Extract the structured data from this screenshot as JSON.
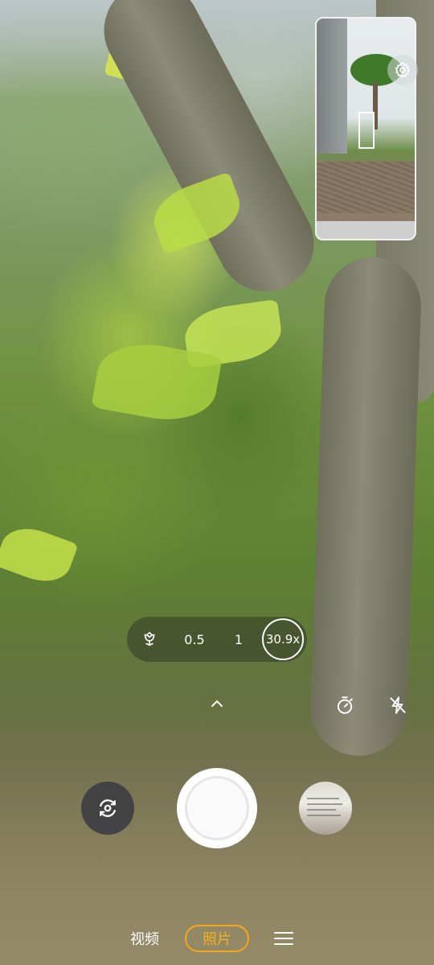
{
  "zoom_bar": {
    "macro_icon": "macro-flower-icon",
    "options": [
      "0.5",
      "1"
    ],
    "current": "30.9x"
  },
  "controls": {
    "expand_icon": "chevron-up-icon",
    "timer_icon": "timer-icon",
    "flash_icon": "flash-off-icon",
    "switch_camera_icon": "switch-camera-icon",
    "settings_icon": "gear-icon"
  },
  "modes": {
    "video": "视频",
    "photo": "照片",
    "more_icon": "menu-icon",
    "selected": "照片"
  },
  "colors": {
    "accent": "#f5a91a"
  }
}
